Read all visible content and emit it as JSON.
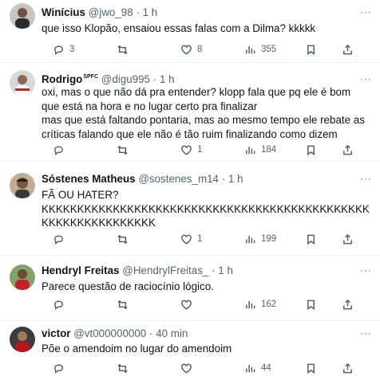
{
  "tweets": [
    {
      "name": "Winícius",
      "badge": "",
      "handle": "@jwo_98",
      "separator": "·",
      "time": "1 h",
      "text": "que isso Klopão, ensaiou essas falas com a Dilma? kkkkk",
      "replies": "3",
      "retweets": "",
      "likes": "8",
      "views": "355"
    },
    {
      "name": "Rodrigo",
      "badge": "SPFC",
      "handle": "@digu995",
      "separator": "·",
      "time": "1 h",
      "text": "oxi, mas o que não dá pra entender? klopp fala que pq ele é bom que está na hora e no lugar certo pra finalizar\nmas que está faltando pontaria, mas ao mesmo tempo ele rebate as críticas falando que ele não é tão ruim finalizando como dizem",
      "replies": "",
      "retweets": "",
      "likes": "1",
      "views": "184"
    },
    {
      "name": "Sóstenes Matheus",
      "badge": "",
      "handle": "@sostenes_m14",
      "separator": "·",
      "time": "1 h",
      "text": "FÃ OU HATER?\nKKKKKKKKKKKKKKKKKKKKKKKKKKKKKKKKKKKKKKKKKKKKKKKKKKKKKKKKKKKKKK",
      "replies": "",
      "retweets": "",
      "likes": "1",
      "views": "199"
    },
    {
      "name": "Hendryl Freitas",
      "badge": "",
      "handle": "@HendrylFreitas_",
      "separator": "·",
      "time": "1 h",
      "text": "Parece questão de raciocínio lógico.",
      "replies": "",
      "retweets": "",
      "likes": "",
      "views": "162"
    },
    {
      "name": "victor",
      "badge": "",
      "handle": "@vt000000000",
      "separator": "·",
      "time": "40 min",
      "text": "Põe o amendoim no lugar do amendoim",
      "replies": "",
      "retweets": "",
      "likes": "",
      "views": "44"
    }
  ],
  "icons": {
    "reply": "reply-icon",
    "retweet": "retweet-icon",
    "like": "heart-icon",
    "views": "views-icon",
    "bookmark": "bookmark-icon",
    "share": "share-icon",
    "more": "more-icon"
  },
  "colors": {
    "text": "#0f1419",
    "secondary": "#536471",
    "divider": "#eff3f4"
  }
}
